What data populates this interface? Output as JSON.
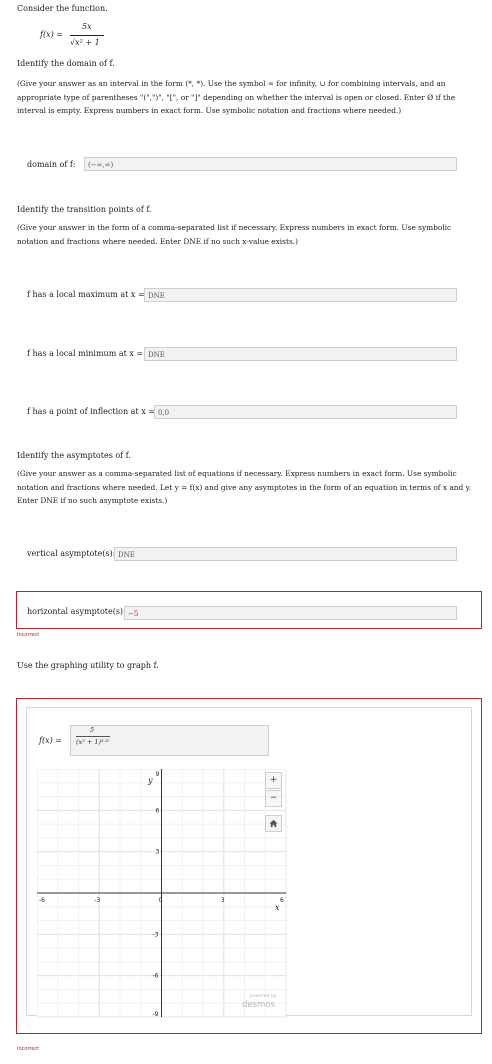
{
  "intro": "Consider the function.",
  "function": {
    "lhs": "f(x) =",
    "numerator": "5x",
    "denominator": "√x² + 1"
  },
  "domain": {
    "prompt": "Identify the domain of f.",
    "instructions": "(Give your answer as an interval in the form (*, *). Use the symbol ∞ for infinity, ∪ for combining intervals, and an appropriate type of parentheses \"(\",\")\", \"[\", or \"]\" depending on whether the interval is open or closed. Enter Ø if the interval is empty. Express numbers in exact form. Use symbolic notation and fractions where needed.)",
    "label": "domain of f:",
    "value": "(−∞,∞)"
  },
  "transition": {
    "prompt": "Identify the transition points of f.",
    "instructions": "(Give your answer in the form of a comma-separated list if necessary. Express numbers in exact form. Use symbolic notation and fractions where needed. Enter DNE if no such x-value exists.)",
    "max_label": "f has a local maximum at x =",
    "max_value": "DNE",
    "min_label": "f has a local minimum at x =",
    "min_value": "DNE",
    "inflection_label": "f has a point of inflection at x =",
    "inflection_value": "0,0"
  },
  "asymptotes": {
    "prompt": "Identify the asymptotes of f.",
    "instructions": "(Give your answer as a comma-separated list of equations if necessary. Express numbers in exact form. Use symbolic notation and fractions where needed. Let y = f(x) and give any asymptotes in the form of an equation in terms of x and y. Enter DNE if no such asymptote exists.)",
    "vertical_label": "vertical asymptote(s):",
    "vertical_value": "DNE",
    "horizontal_label": "horizontal asymptote(s):",
    "horizontal_value": "−5",
    "incorrect": "Incorrect"
  },
  "graph": {
    "prompt": "Use the graphing utility to graph f.",
    "expr_lhs": "f(x) =",
    "expr_numerator": "5",
    "expr_denominator": "(x² + 1)³ᐟ²",
    "y_axis_label": "y",
    "x_axis_label": "x",
    "zoom_in": "+",
    "zoom_out": "−",
    "home_icon": "home-icon",
    "powered_by": "powered by",
    "brand": "desmos",
    "incorrect": "Incorrect"
  },
  "chart_data": {
    "type": "line",
    "xlim": [
      -6,
      6
    ],
    "ylim": [
      -9,
      9
    ],
    "x_ticks": [
      -6,
      -3,
      0,
      3,
      6
    ],
    "y_ticks": [
      9,
      6,
      3,
      0,
      -3,
      -6,
      -9
    ],
    "grid": true,
    "series": []
  }
}
